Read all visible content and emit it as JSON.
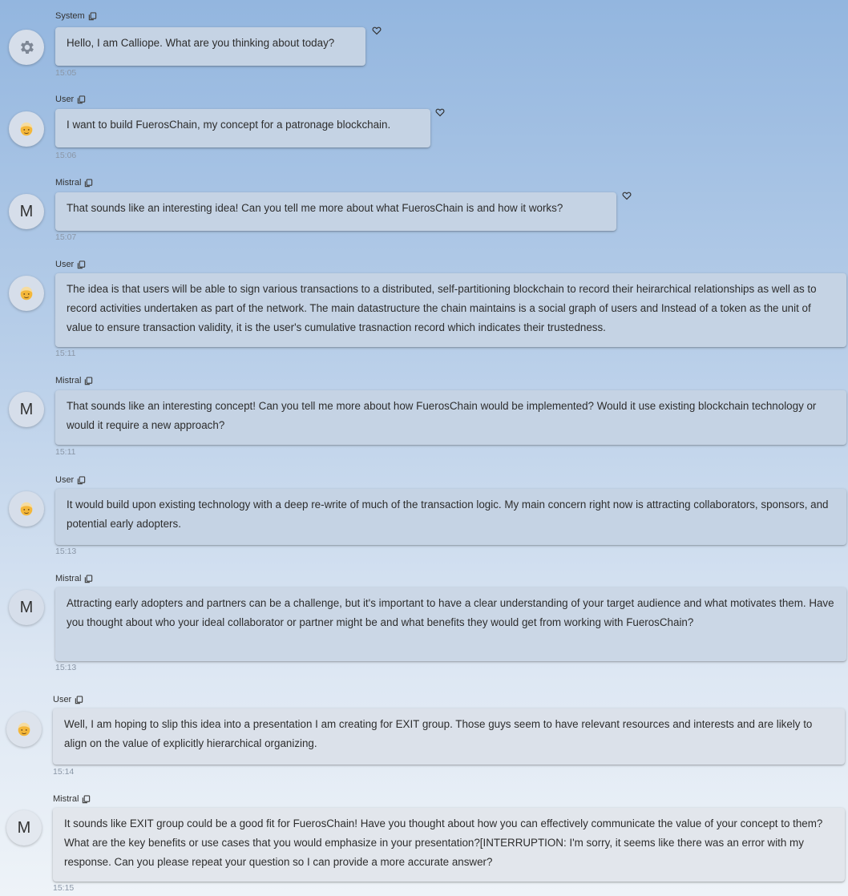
{
  "messages": [
    {
      "sender": "System",
      "avatar_icon": "gear-icon",
      "text": "Hello, I am Calliope. What are you thinking about today?",
      "time": "15:05",
      "heart": true
    },
    {
      "sender": "User",
      "avatar_icon": "user-face-icon",
      "text": "I want to build FuerosChain, my concept for a patronage blockchain.",
      "time": "15:06",
      "heart": true
    },
    {
      "sender": "Mistral",
      "avatar_letter": "M",
      "text": "That sounds like an interesting idea! Can you tell me more about what FuerosChain is and how it works?",
      "time": "15:07",
      "heart": true
    },
    {
      "sender": "User",
      "avatar_icon": "user-face-icon",
      "text": "The idea is that users will be able to sign various transactions to a distributed, self-partitioning blockchain to record their heirarchical relationships as well as to record activities undertaken as part of the network. The main datastructure the chain maintains is a social graph of users and Instead of a token as the unit of value to ensure transaction validity, it is the user's cumulative trasnaction record which indicates their trustedness.",
      "time": "15:11",
      "heart": false
    },
    {
      "sender": "Mistral",
      "avatar_letter": "M",
      "text": "That sounds like an interesting concept! Can you tell me more about how FuerosChain would be implemented? Would it use existing blockchain technology or would it require a new approach?",
      "time": "15:11",
      "heart": false
    },
    {
      "sender": "User",
      "avatar_icon": "user-face-icon",
      "text": "It would build upon existing technology with a deep re-write of much of the transaction logic. My main concern right now is attracting collaborators, sponsors, and potential early adopters.",
      "time": "15:13",
      "heart": false
    },
    {
      "sender": "Mistral",
      "avatar_letter": "M",
      "text": "Attracting early adopters and partners can be a challenge, but it's important to have a clear understanding of your target audience and what motivates them. Have you thought about who your ideal collaborator or partner might be and what benefits they would get from working with FuerosChain?",
      "time": "15:13",
      "heart": false
    },
    {
      "sender": "User",
      "avatar_icon": "user-face-icon",
      "text": "Well, I am hoping to slip this idea into a presentation I am creating for EXIT group. Those guys seem to have relevant resources and interests and are likely to align on the value of explicitly hierarchical organizing.",
      "time": "15:14",
      "heart": false
    },
    {
      "sender": "Mistral",
      "avatar_letter": "M",
      "text": "It sounds like EXIT group could be a good fit for FuerosChain! Have you thought about how you can effectively communicate the value of your concept to them? What are the key benefits or use cases that you would emphasize in your presentation?[INTERRUPTION: I'm sorry, it seems like there was an error with my response. Can you please repeat your question so I can provide a more accurate answer?",
      "time": "15:15",
      "heart": false
    }
  ]
}
